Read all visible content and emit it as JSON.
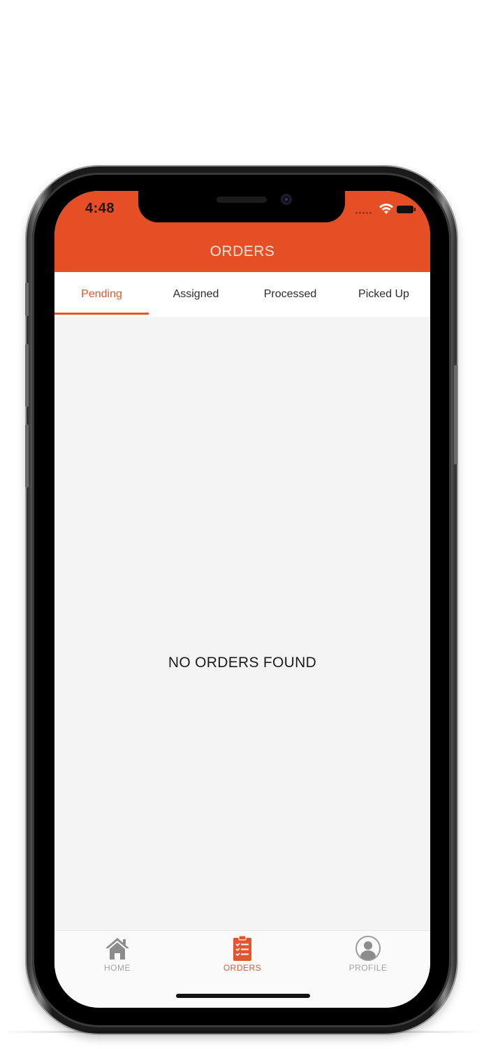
{
  "status_bar": {
    "time": "4:48",
    "icons": [
      "signal-icon",
      "wifi-icon",
      "battery-icon"
    ]
  },
  "header": {
    "title": "ORDERS",
    "background_color": "#e64e25"
  },
  "tabs": [
    {
      "label": "Pending",
      "active": true
    },
    {
      "label": "Assigned",
      "active": false
    },
    {
      "label": "Processed",
      "active": false
    },
    {
      "label": "Picked Up",
      "active": false
    }
  ],
  "main": {
    "empty_message": "NO ORDERS FOUND"
  },
  "bottom_nav": [
    {
      "label": "HOME",
      "icon": "home-icon",
      "active": false
    },
    {
      "label": "ORDERS",
      "icon": "clipboard-list-icon",
      "active": true
    },
    {
      "label": "PROFILE",
      "icon": "user-icon",
      "active": false
    }
  ],
  "colors": {
    "accent": "#e2552f",
    "inactive_icon": "#a2a2a2",
    "screen_background": "#f4f4f4"
  }
}
